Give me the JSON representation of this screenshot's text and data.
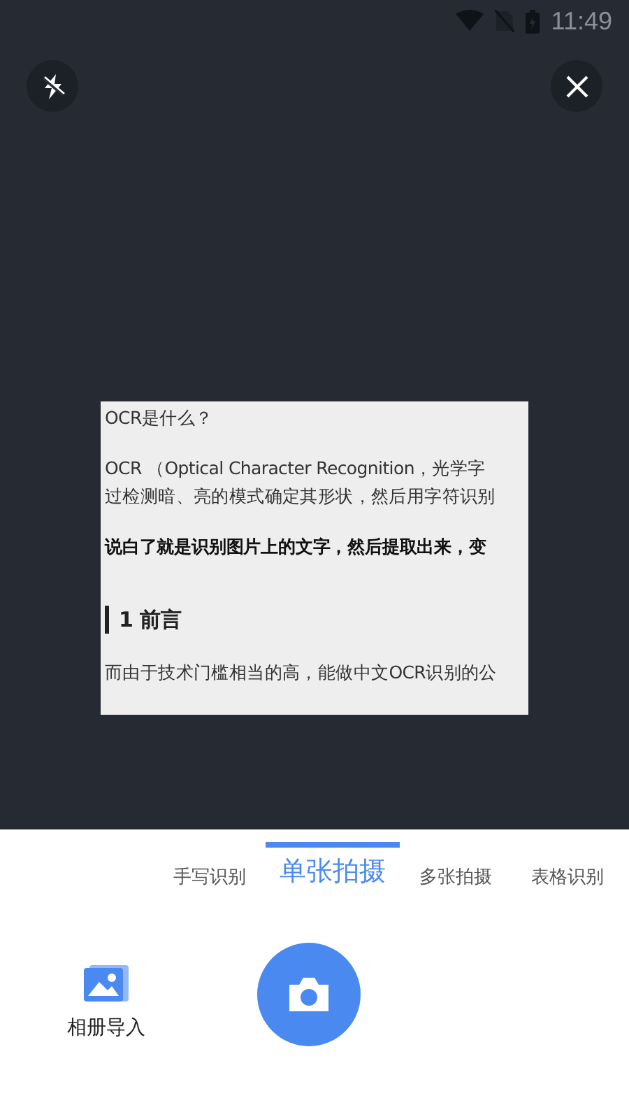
{
  "status_bar": {
    "time": "11:49"
  },
  "camera": {
    "flash_on": false,
    "document": [
      {
        "kind": "text",
        "text": "OCR是什么？"
      },
      {
        "kind": "text",
        "text": "OCR （Optical Character Recognition，光学字"
      },
      {
        "kind": "text",
        "text": "过检测暗、亮的模式确定其形状，然后用字符识别"
      },
      {
        "kind": "bold",
        "text": "说白了就是识别图片上的文字，然后提取出来，变"
      },
      {
        "kind": "heading",
        "text": "1 前言"
      },
      {
        "kind": "text",
        "text": "而由于技术门槛相当的高，能做中文OCR识别的公"
      }
    ]
  },
  "tabs": [
    {
      "label": "手写识别",
      "selected": false
    },
    {
      "label": "单张拍摄",
      "selected": true
    },
    {
      "label": "多张拍摄",
      "selected": false
    },
    {
      "label": "表格识别",
      "selected": false
    }
  ],
  "album_button": {
    "label": "相册导入"
  }
}
